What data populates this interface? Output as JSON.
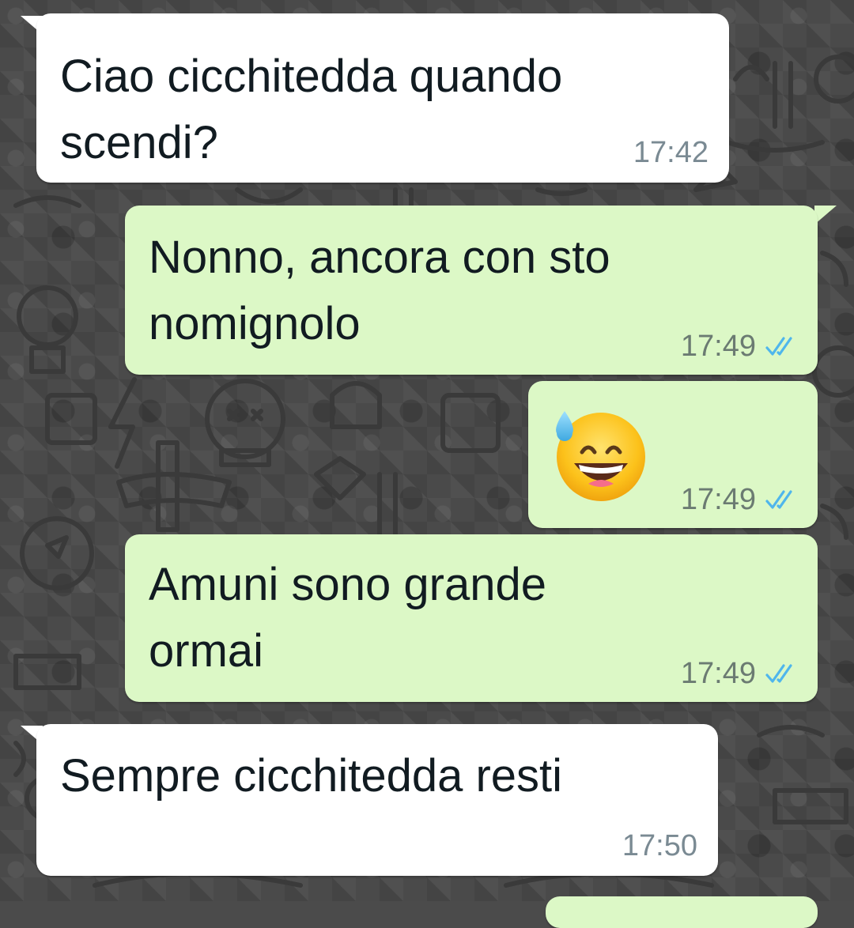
{
  "chat": {
    "messages": [
      {
        "direction": "incoming",
        "text": "Ciao cicchitedda quando\nscendi?",
        "time": "17:42"
      },
      {
        "direction": "outgoing",
        "text": "Nonno, ancora con sto\nnomignolo",
        "time": "17:49",
        "status": "read-double-check-icon"
      },
      {
        "direction": "outgoing",
        "text": "",
        "emoji": "grinning-face-with-sweat-emoji",
        "time": "17:49",
        "status": "read-double-check-icon"
      },
      {
        "direction": "outgoing",
        "text": "Amuni sono grande\normai",
        "time": "17:49",
        "status": "read-double-check-icon"
      },
      {
        "direction": "incoming",
        "text": "Sempre cicchitedda resti",
        "time": "17:50"
      }
    ]
  },
  "colors": {
    "incoming_bubble": "#ffffff",
    "outgoing_bubble": "#dcf8c6",
    "read_ticks": "#4fb6ec",
    "wallpaper": "#4a4a4a"
  }
}
